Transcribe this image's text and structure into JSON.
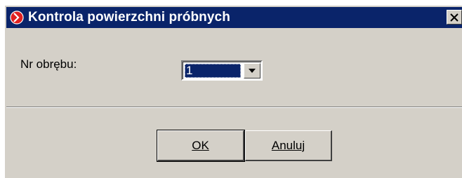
{
  "window": {
    "title": "Kontrola powierzchni próbnych",
    "app_icon": "red-circle-app-icon",
    "close_icon": "close-x-icon"
  },
  "form": {
    "nr_obrebu_label": "Nr obrębu:",
    "nr_obrebu_value": "1",
    "dropdown_icon": "chevron-down-icon"
  },
  "buttons": {
    "ok_label": "OK",
    "cancel_label": "Anuluj"
  },
  "colors": {
    "titlebar": "#0a246a",
    "face": "#d4d0c8",
    "selection": "#0a246a"
  }
}
